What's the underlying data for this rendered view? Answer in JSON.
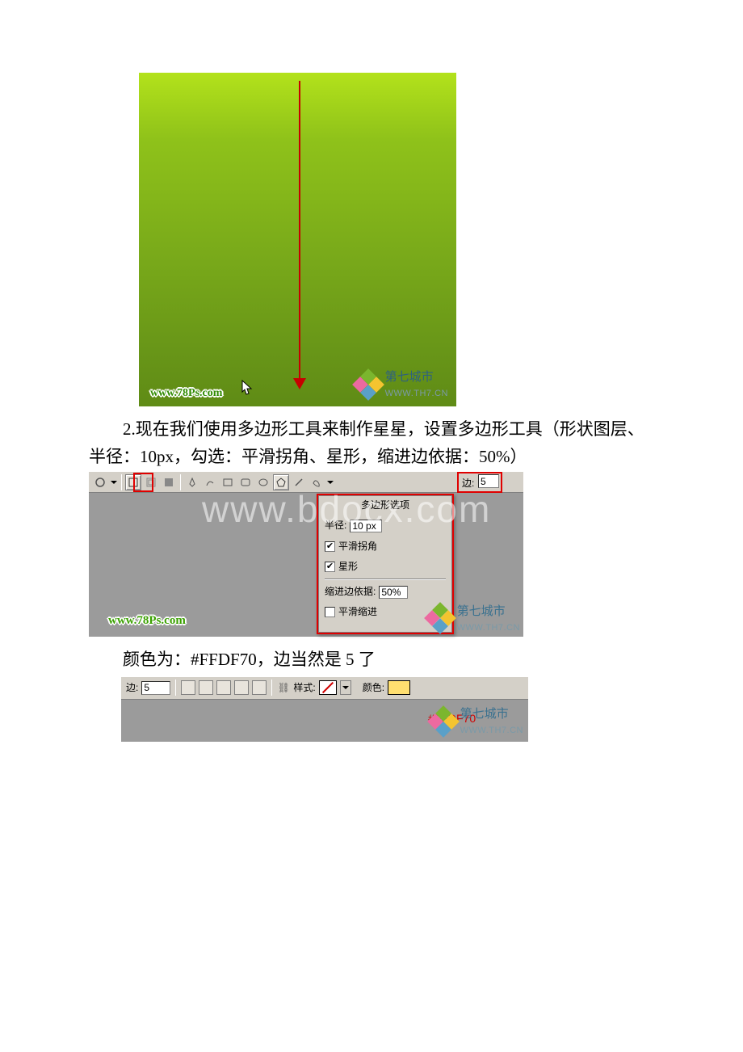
{
  "watermarks": {
    "site1": "www.78Ps.com",
    "site2_cn": "第七城市",
    "site2_en": "WWW.TH7.CN",
    "bg": "www.bdocx.com"
  },
  "fig2": {
    "sides_label": "边:",
    "sides_value": "5",
    "popup_title": "多边形选项",
    "radius_label": "半径:",
    "radius_value": "10 px",
    "smooth_corners": "平滑拐角",
    "star": "星形",
    "indent_label": "缩进边依据:",
    "indent_value": "50%",
    "smooth_indent": "平滑缩进"
  },
  "fig3": {
    "sides_label": "边:",
    "sides_value": "5",
    "style_label": "样式:",
    "color_label": "颜色:",
    "hex": "#FFDF70"
  },
  "text": {
    "p1": "2.现在我们使用多边形工具来制作星星，设置多边形工具（形状图层、半径：10px，勾选：平滑拐角、星形，缩进边依据：50%）",
    "p2": "颜色为：#FFDF70，边当然是 5 了"
  }
}
